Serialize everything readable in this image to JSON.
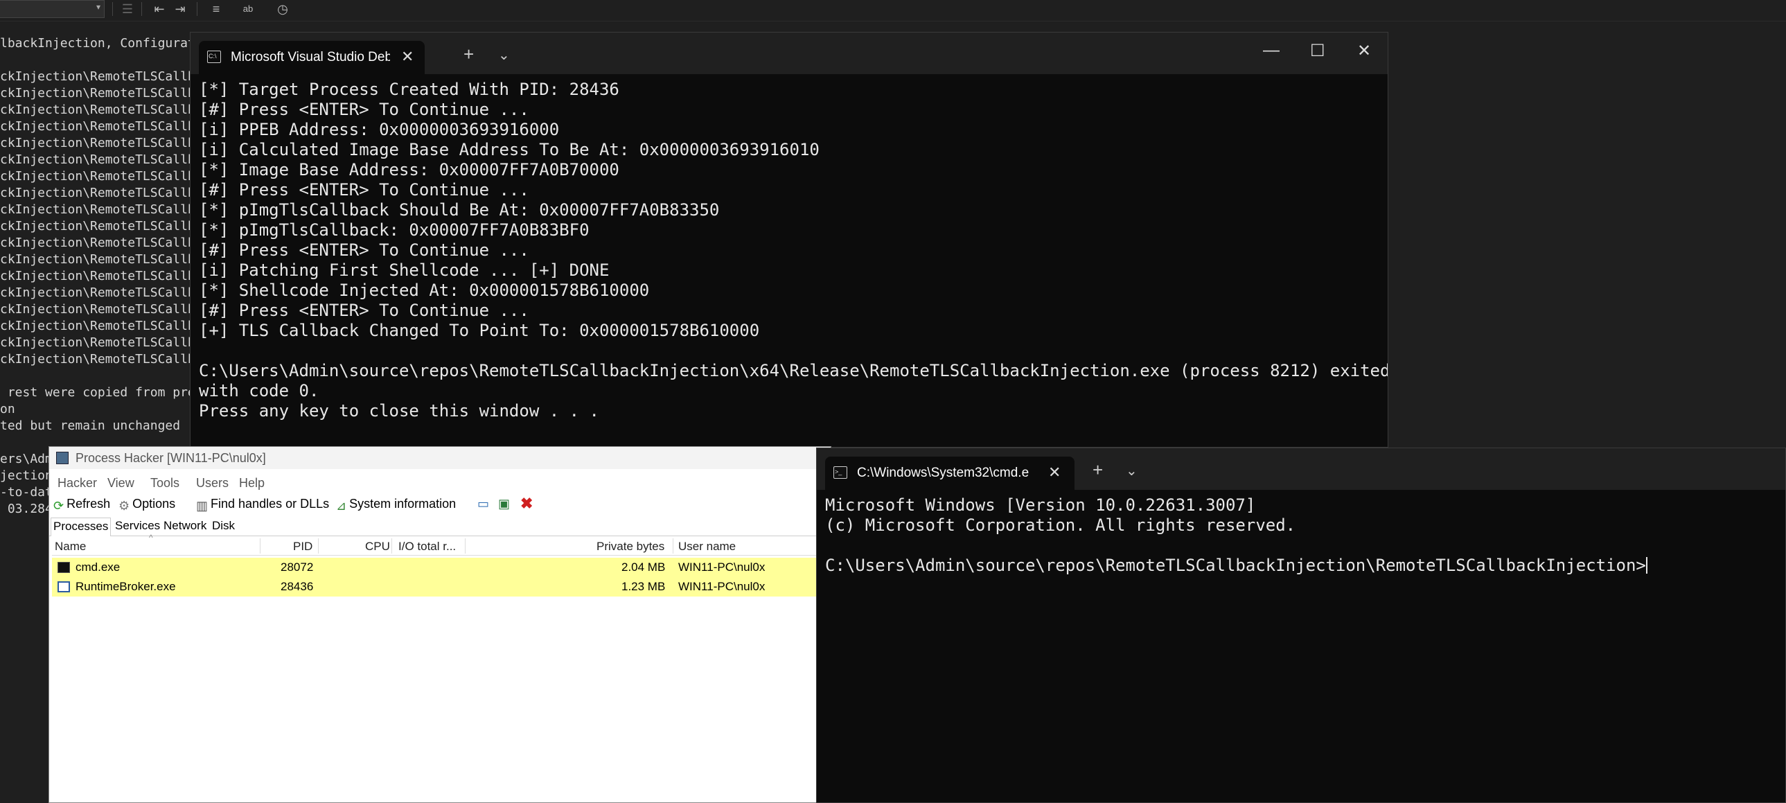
{
  "vs_output": {
    "lines": [
      "lbackInjection, Configurati",
      "",
      "ckInjection\\RemoteTLSCallbac",
      "ckInjection\\RemoteTLSCallbac",
      "ckInjection\\RemoteTLSCallbac",
      "ckInjection\\RemoteTLSCallbac",
      "ckInjection\\RemoteTLSCallbac",
      "ckInjection\\RemoteTLSCallbac",
      "ckInjection\\RemoteTLSCallbac",
      "ckInjection\\RemoteTLSCallbac",
      "ckInjection\\RemoteTLSCallbac",
      "ckInjection\\RemoteTLSCallbac",
      "ckInjection\\RemoteTLSCallbac",
      "ckInjection\\RemoteTLSCallbac",
      "ckInjection\\RemoteTLSCallbac",
      "ckInjection\\RemoteTLSCallbac",
      "ckInjection\\RemoteTLSCallbac",
      "ckInjection\\RemoteTLSCallbac",
      "ckInjection\\RemoteTLSCallbac",
      "ckInjection\\RemoteTLSCallbac",
      "",
      " rest were copied from previ",
      "on",
      "ted but remain unchanged",
      "",
      "ers\\Adm",
      "jection.",
      "-to-dat",
      " 03.284"
    ]
  },
  "debug_console": {
    "tab_title": "Microsoft Visual Studio Debug",
    "lines": [
      "[*] Target Process Created With PID: 28436",
      "[#] Press <ENTER> To Continue ...",
      "[i] PPEB Address: 0x0000003693916000",
      "[i] Calculated Image Base Address To Be At: 0x0000003693916010",
      "[*] Image Base Address: 0x00007FF7A0B70000",
      "[#] Press <ENTER> To Continue ...",
      "[*] pImgTlsCallback Should Be At: 0x00007FF7A0B83350",
      "[*] pImgTlsCallback: 0x00007FF7A0B83BF0",
      "[#] Press <ENTER> To Continue ...",
      "[i] Patching First Shellcode ... [+] DONE",
      "[*] Shellcode Injected At: 0x000001578B610000",
      "[#] Press <ENTER> To Continue ...",
      "[+] TLS Callback Changed To Point To: 0x000001578B610000",
      "",
      "C:\\Users\\Admin\\source\\repos\\RemoteTLSCallbackInjection\\x64\\Release\\RemoteTLSCallbackInjection.exe (process 8212) exited",
      "with code 0.",
      "Press any key to close this window . . ."
    ]
  },
  "process_hacker": {
    "title": "Process Hacker [WIN11-PC\\nul0x]",
    "menu": [
      "Hacker",
      "View",
      "Tools",
      "Users",
      "Help"
    ],
    "toolbar": {
      "refresh": "Refresh",
      "options": "Options",
      "find_handles": "Find handles or DLLs",
      "system_info": "System information"
    },
    "tabs": [
      "Processes",
      "Services",
      "Network",
      "Disk"
    ],
    "columns": {
      "name": "Name",
      "pid": "PID",
      "cpu": "CPU",
      "io": "I/O total r...",
      "private": "Private bytes",
      "user": "User name"
    },
    "rows": [
      {
        "name": "cmd.exe",
        "pid": "28072",
        "private": "2.04 MB",
        "user": "WIN11-PC\\nul0x"
      },
      {
        "name": "RuntimeBroker.exe",
        "pid": "28436",
        "private": "1.23 MB",
        "user": "WIN11-PC\\nul0x"
      }
    ]
  },
  "cmd_window": {
    "tab_title": "C:\\Windows\\System32\\cmd.e",
    "lines": [
      "Microsoft Windows [Version 10.0.22631.3007]",
      "(c) Microsoft Corporation. All rights reserved.",
      "",
      "C:\\Users\\Admin\\source\\repos\\RemoteTLSCallbackInjection\\RemoteTLSCallbackInjection>"
    ]
  },
  "colors": {
    "terminal_bg": "#0c0c0c",
    "titlebar_bg": "#202020",
    "ph_highlight": "#ffff99"
  }
}
